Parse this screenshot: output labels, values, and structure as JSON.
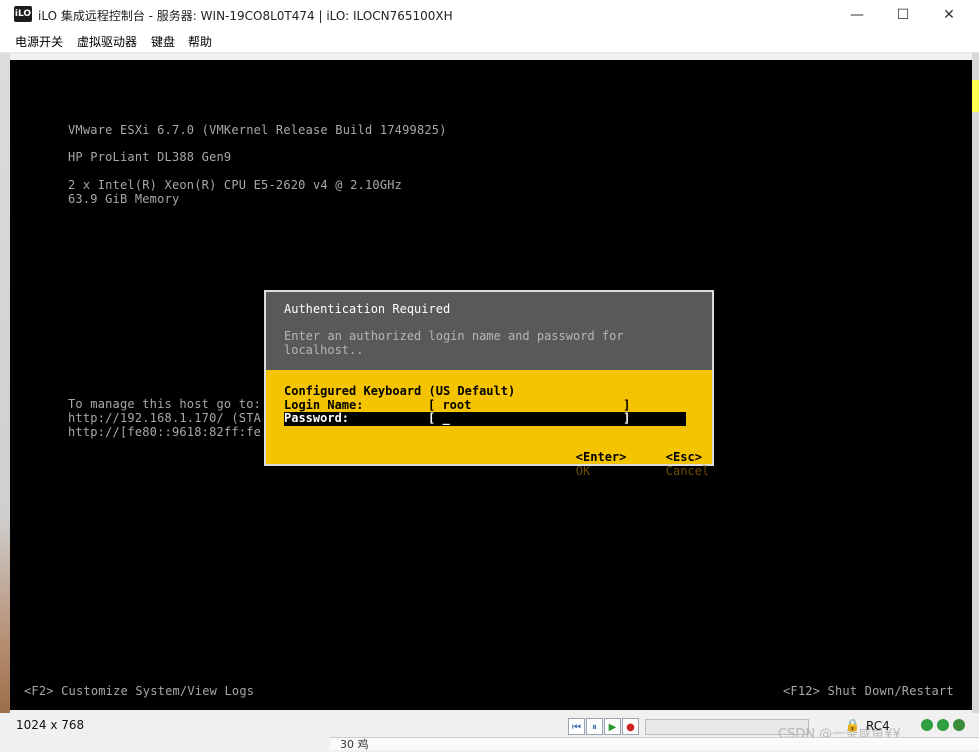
{
  "window": {
    "logo": "iLO",
    "title": "iLO 集成远程控制台 - 服务器: WIN-19CO8L0T474 | iLO: ILOCN765100XH",
    "minimize": "—",
    "maximize": "☐",
    "close": "✕"
  },
  "menu": [
    "电源开关",
    "虚拟驱动器",
    "键盘",
    "帮助"
  ],
  "console": {
    "lines": [
      "VMware ESXi 6.7.0 (VMKernel Release Build 17499825)",
      "HP ProLiant DL388 Gen9",
      "2 x Intel(R) Xeon(R) CPU E5-2620 v4 @ 2.10GHz",
      "63.9 GiB Memory",
      "To manage this host go to:",
      "http://192.168.1.170/ (STA",
      "http://[fe80::9618:82ff:fe"
    ],
    "footer_left": "<F2> Customize System/View Logs",
    "footer_right": "<F12> Shut Down/Restart"
  },
  "dialog": {
    "title": "Authentication Required",
    "message": "Enter an authorized login name and password for\nlocalhost..",
    "keyboard": "Configured Keyboard (US Default)",
    "login_label": "Login Name:",
    "login_value": "[ root                     ]",
    "password_label": "Password:",
    "password_value": "[ _                        ]",
    "enter_key": "<Enter>",
    "enter_label": "OK",
    "esc_key": "<Esc>",
    "esc_label": "Cancel"
  },
  "status": {
    "resolution": "1024 x 768",
    "controls": [
      "⏮",
      "⏸",
      "▶",
      "●"
    ],
    "encryption": "RC4",
    "watermark": "CSDN @一条咸鱼¥¥",
    "below_text": "30  鸡"
  },
  "colors": {
    "dialog_yellow": "#f5c400",
    "dialog_gray": "#595959",
    "console_bg": "#000000",
    "console_text": "#a8a8a8"
  }
}
